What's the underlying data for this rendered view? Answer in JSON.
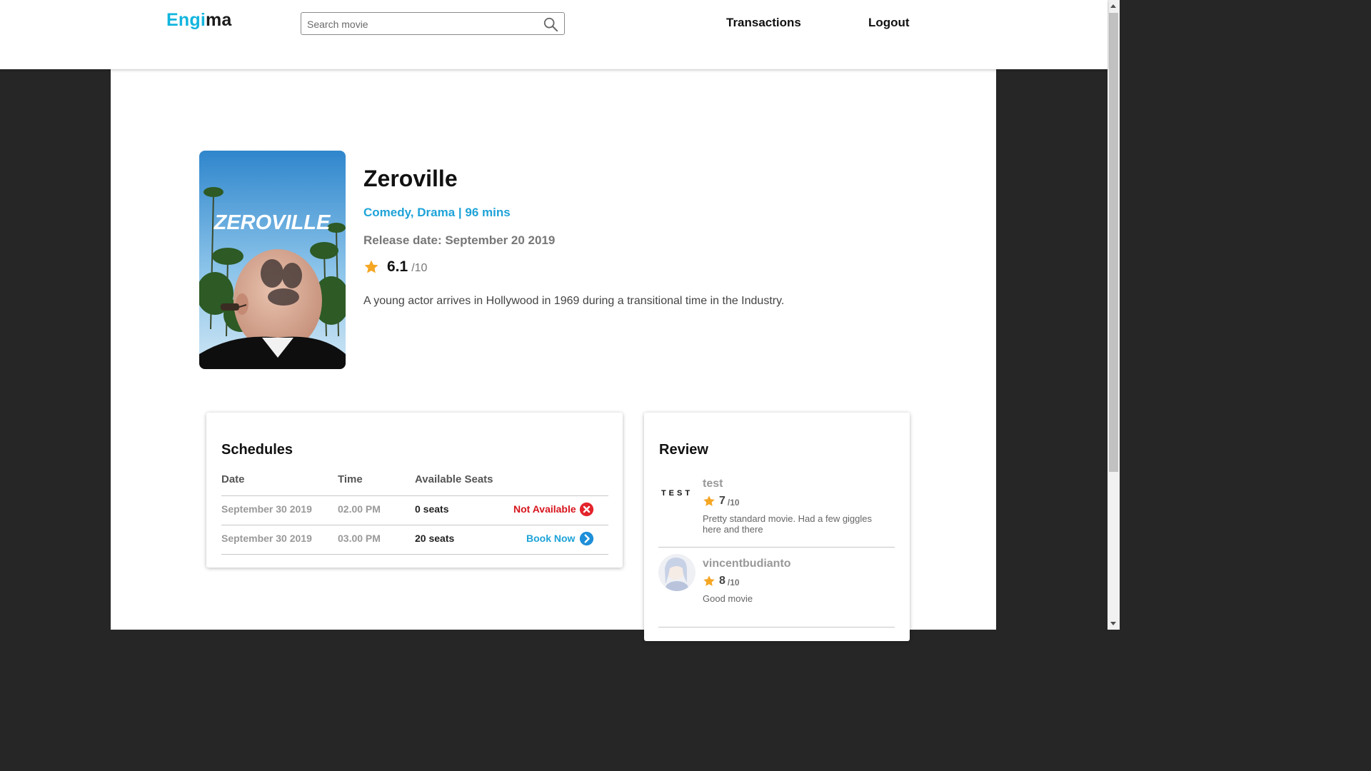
{
  "brand": {
    "part1": "Engi",
    "part2": "ma"
  },
  "search": {
    "placeholder": "Search movie"
  },
  "nav": {
    "transactions": "Transactions",
    "logout": "Logout"
  },
  "movie": {
    "title": "Zeroville",
    "genres_runtime": "Comedy, Drama | 96 mins",
    "release": "Release date: September 20 2019",
    "rating": "6.1",
    "rating_max": "/10",
    "synopsis": "A young actor arrives in Hollywood in 1969 during a transitional time in the Industry.",
    "poster_text": "ZEROVILLE"
  },
  "schedules": {
    "title": "Schedules",
    "headers": [
      "Date",
      "Time",
      "Available Seats"
    ],
    "rows": [
      {
        "date": "September 30 2019",
        "time": "02.00 PM",
        "seats": "0 seats",
        "action": "Not Available",
        "status": "unavailable"
      },
      {
        "date": "September 30 2019",
        "time": "03.00 PM",
        "seats": "20 seats",
        "action": "Book Now",
        "status": "available"
      }
    ]
  },
  "reviews": {
    "title": "Review",
    "items": [
      {
        "user": "test",
        "avatar_text": "TEST",
        "score": "7",
        "max": "/10",
        "text": "Pretty standard movie. Had a few giggles here and there"
      },
      {
        "user": "vincentbudianto",
        "score": "8",
        "max": "/10",
        "text": "Good movie"
      }
    ]
  },
  "colors": {
    "accent": "#1ea3d8",
    "brand": "#12b5de",
    "danger": "#d7141c",
    "star": "#f5a623",
    "backdrop": "#262626"
  }
}
